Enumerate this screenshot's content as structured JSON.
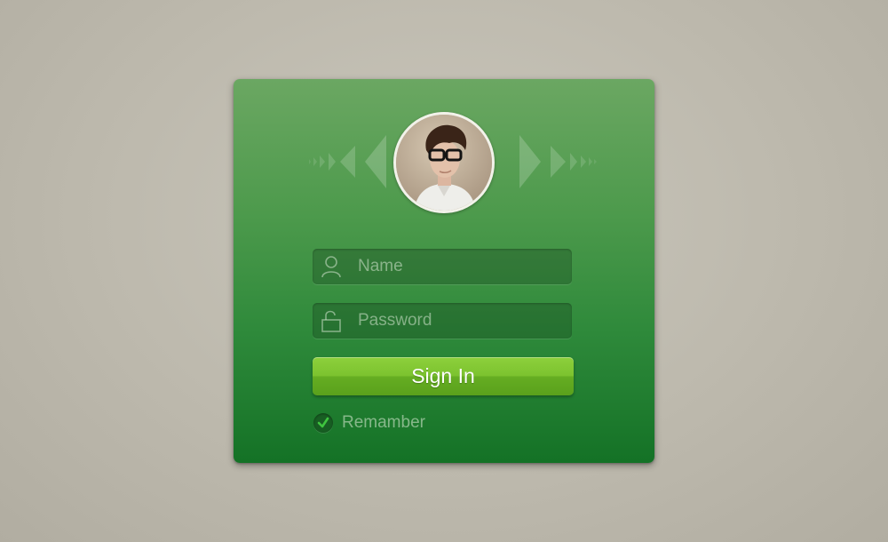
{
  "login": {
    "name_placeholder": "Name",
    "password_placeholder": "Password",
    "signin_label": "Sign In",
    "remember_label": "Remamber",
    "remember_checked": true
  },
  "icons": {
    "user": "user-icon",
    "lock": "lock-icon",
    "check": "checkmark-icon"
  },
  "colors": {
    "card_top": "#6ba762",
    "card_bottom": "#147226",
    "button": "#7cc32f",
    "page_background": "#c2bfb4"
  }
}
